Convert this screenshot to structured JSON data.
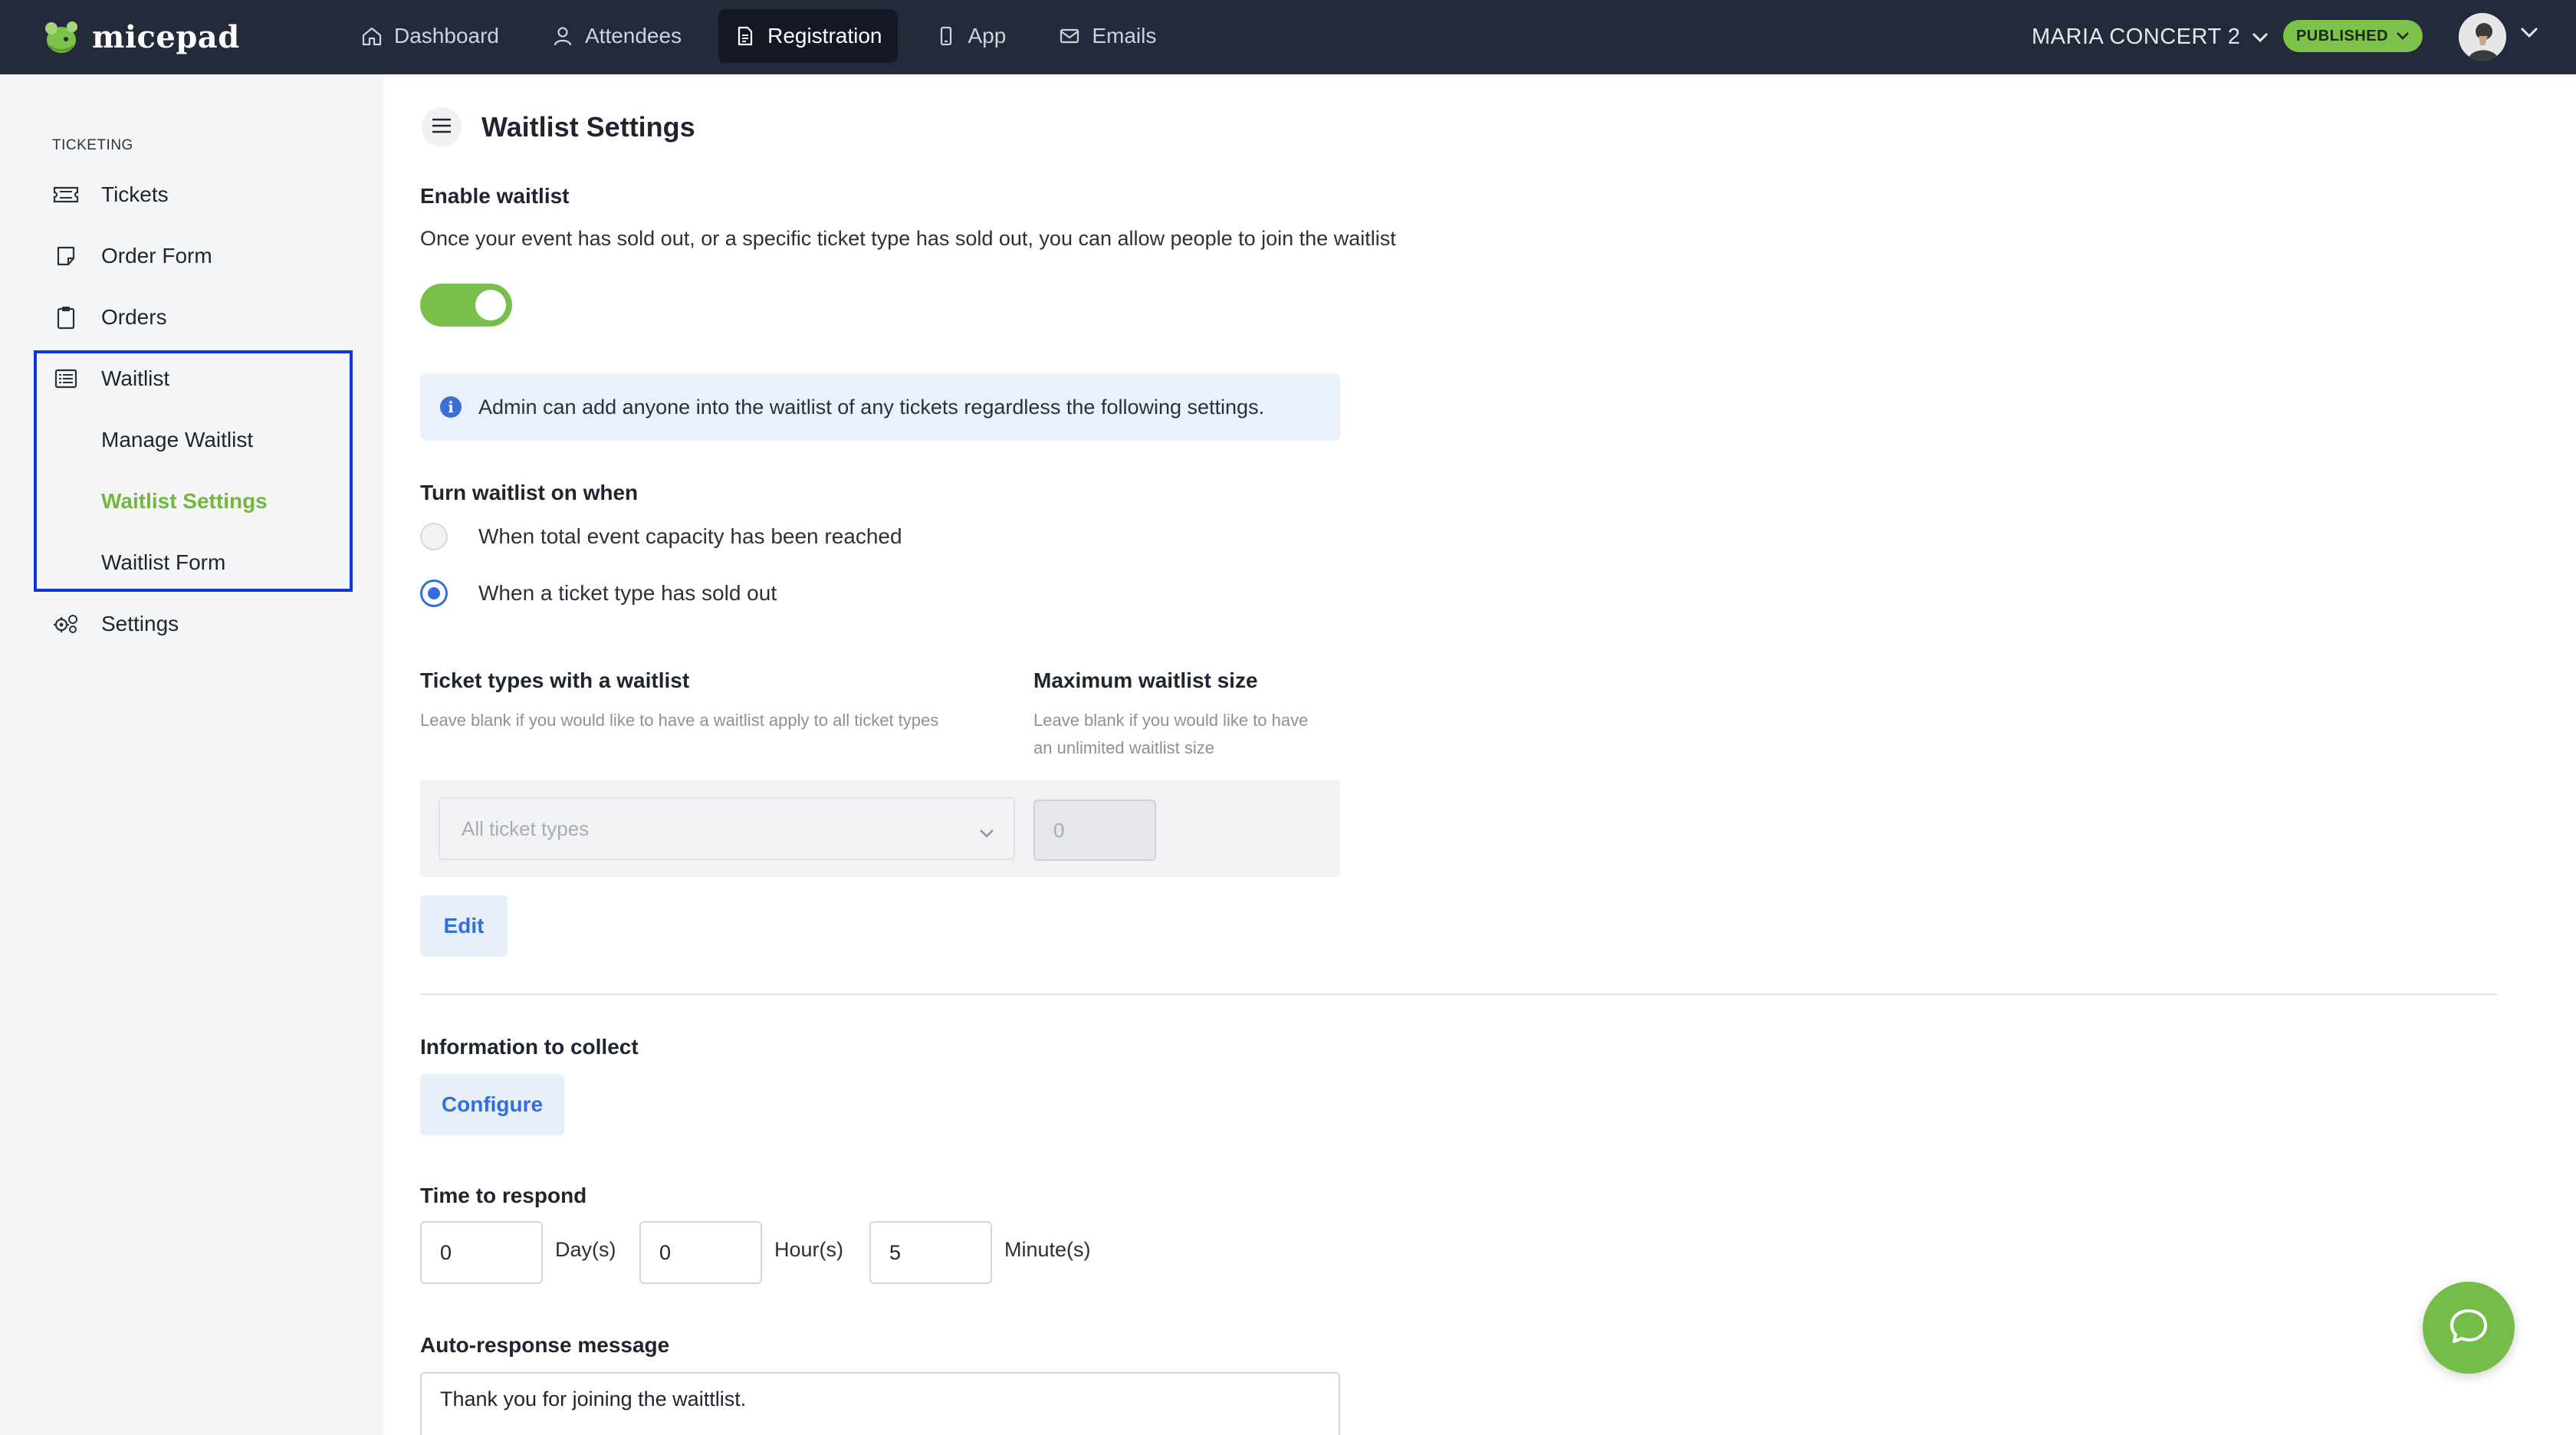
{
  "app": {
    "name": "micepad"
  },
  "nav": {
    "items": [
      {
        "label": "Dashboard",
        "icon": "home-icon"
      },
      {
        "label": "Attendees",
        "icon": "user-icon"
      },
      {
        "label": "Registration",
        "icon": "document-icon",
        "active": true
      },
      {
        "label": "App",
        "icon": "phone-icon"
      },
      {
        "label": "Emails",
        "icon": "mail-icon"
      }
    ],
    "event_name": "MARIA CONCERT 2",
    "status_badge": "PUBLISHED"
  },
  "sidebar": {
    "section": "TICKETING",
    "items": [
      {
        "label": "Tickets",
        "icon": "ticket-icon"
      },
      {
        "label": "Order Form",
        "icon": "form-icon"
      },
      {
        "label": "Orders",
        "icon": "clipboard-icon"
      },
      {
        "label": "Waitlist",
        "icon": "list-icon"
      },
      {
        "label": "Settings",
        "icon": "gears-icon"
      }
    ],
    "waitlist_sub": [
      {
        "label": "Manage Waitlist"
      },
      {
        "label": "Waitlist Settings",
        "active": true
      },
      {
        "label": "Waitlist Form"
      }
    ]
  },
  "page": {
    "title": "Waitlist Settings",
    "enable": {
      "label": "Enable waitlist",
      "description": "Once your event has sold out, or a specific ticket type has sold out, you can allow people to join the waitlist",
      "enabled": true
    },
    "info": "Admin can add anyone into the waitlist of any tickets regardless the following settings.",
    "turn_on": {
      "label": "Turn waitlist on when",
      "options": [
        {
          "label": "When total event capacity has been reached",
          "checked": false
        },
        {
          "label": "When a ticket type has sold out",
          "checked": true
        }
      ]
    },
    "ticket_types": {
      "label": "Ticket types with a waitlist",
      "hint": "Leave blank if you would like to have a waitlist apply to all ticket types",
      "placeholder": "All ticket types"
    },
    "max_size": {
      "label": "Maximum waitlist size",
      "hint_line1": "Leave blank if you would like to have",
      "hint_line2": "an unlimited waitlist size",
      "value": "0"
    },
    "edit_label": "Edit",
    "info_collect": {
      "label": "Information to collect",
      "button": "Configure"
    },
    "time_to_respond": {
      "label": "Time to respond",
      "days": "0",
      "days_unit": "Day(s)",
      "hours": "0",
      "hours_unit": "Hour(s)",
      "minutes": "5",
      "minutes_unit": "Minute(s)"
    },
    "auto_response": {
      "label": "Auto-response message",
      "value": "Thank you for joining the waittlist."
    }
  },
  "colors": {
    "topbar": "#232b3a",
    "accent_green": "#74bd48",
    "link_blue": "#2f6fe0",
    "highlight_border": "#1034d9"
  }
}
